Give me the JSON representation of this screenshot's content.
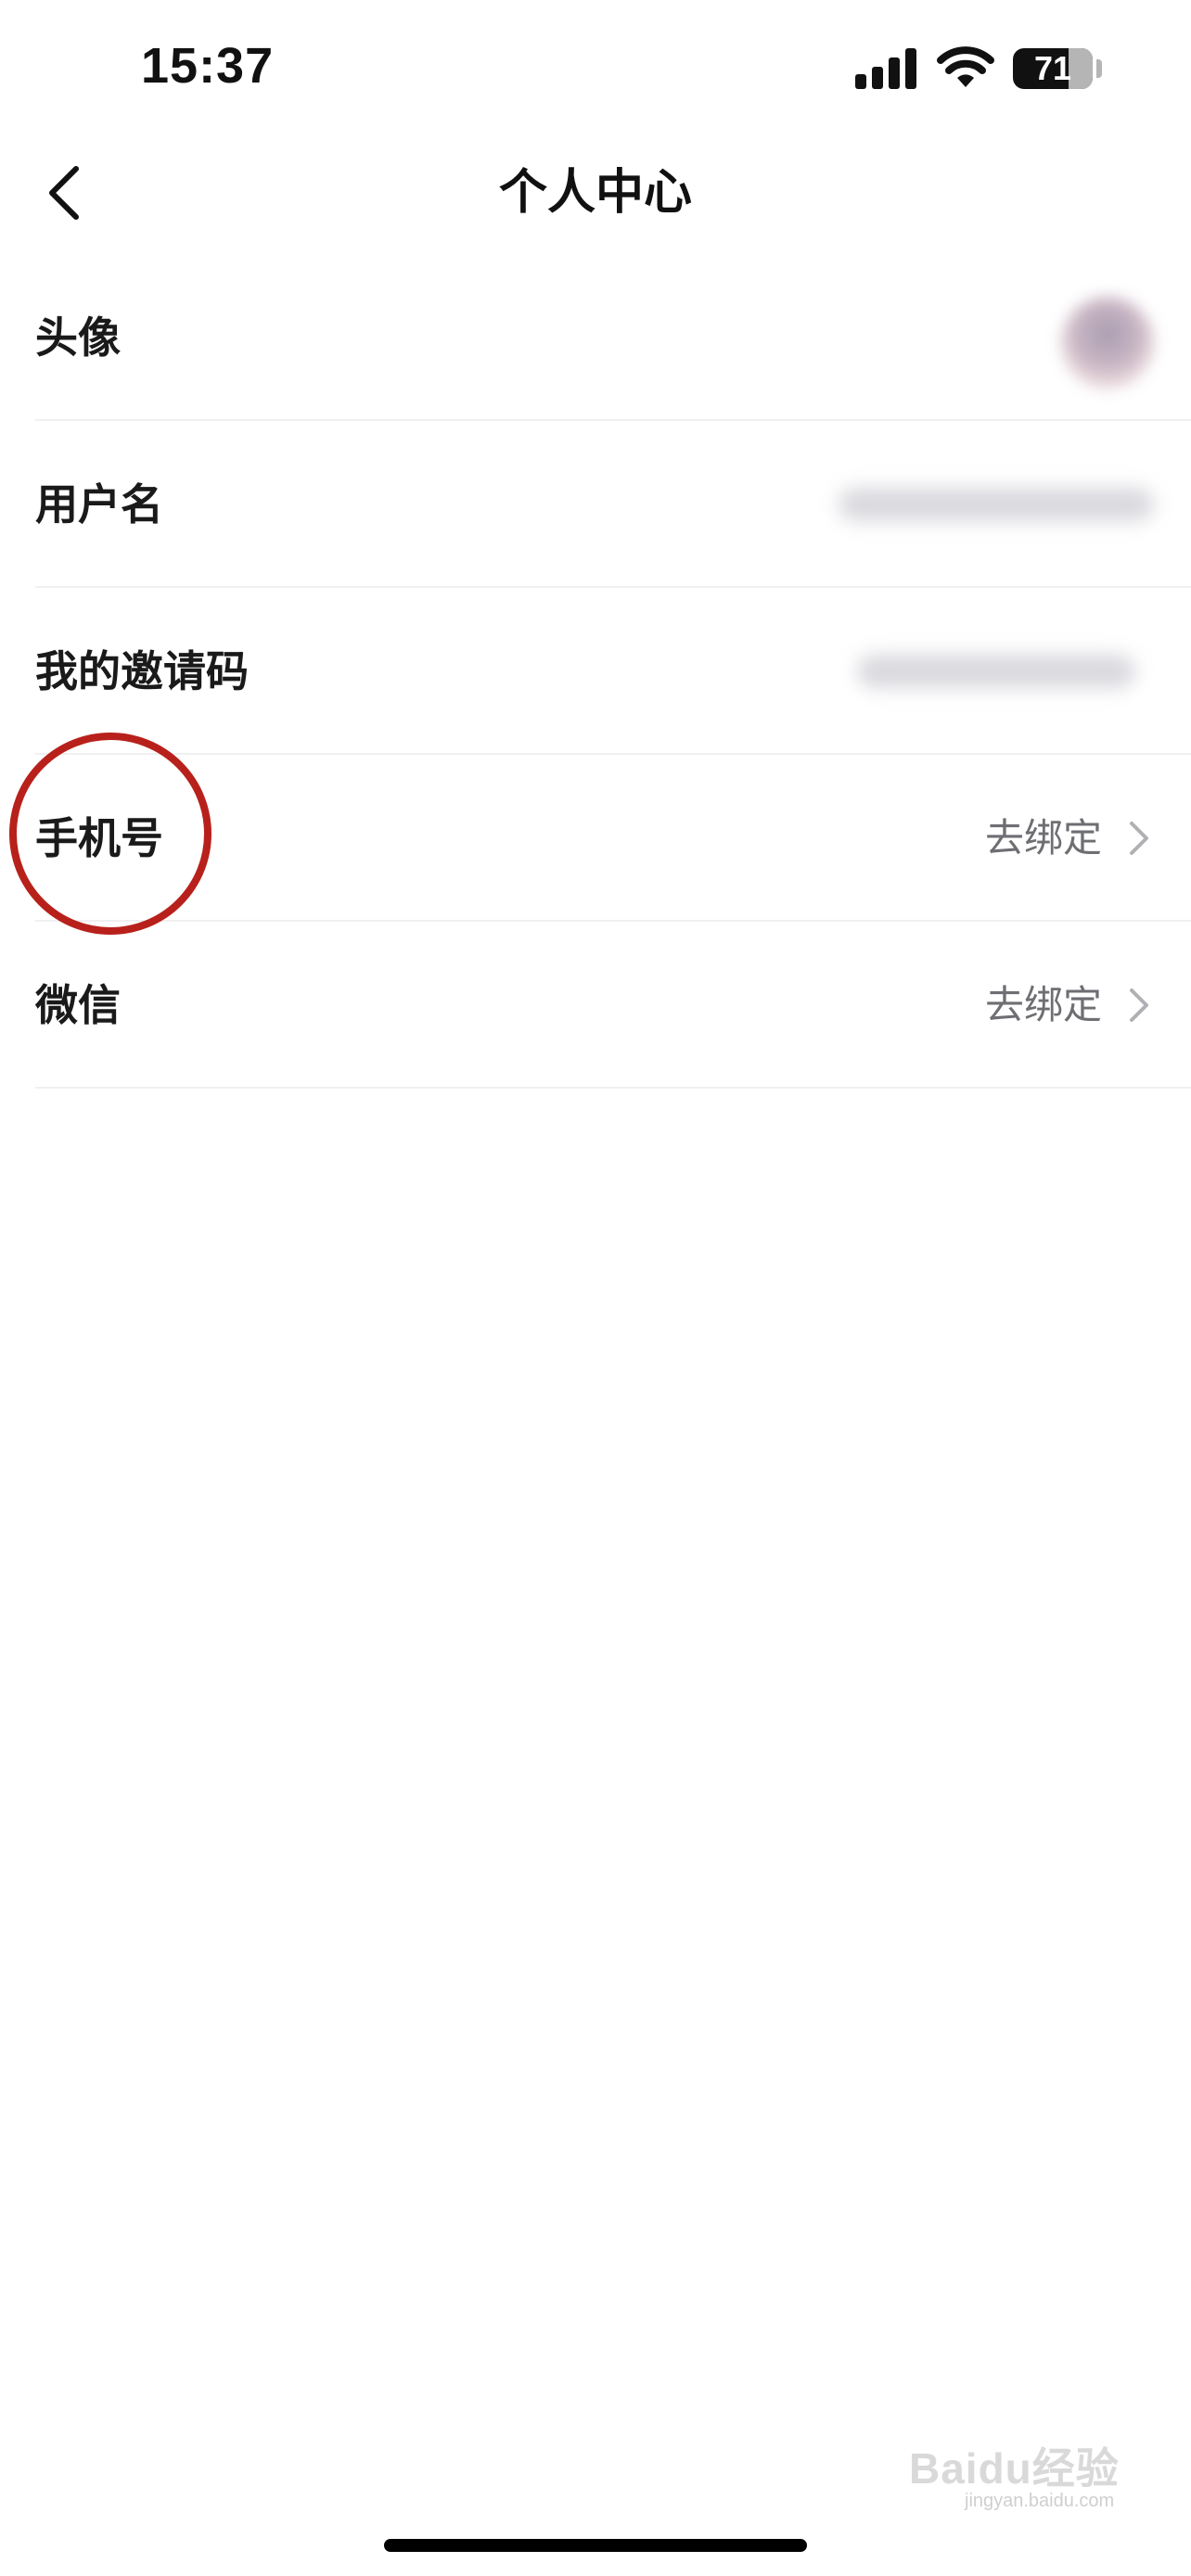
{
  "status_bar": {
    "time": "15:37",
    "battery": "71"
  },
  "nav": {
    "title": "个人中心",
    "back_icon": "chevron-left-icon"
  },
  "rows": [
    {
      "label": "头像"
    },
    {
      "label": "用户名"
    },
    {
      "label": "我的邀请码"
    },
    {
      "label": "手机号",
      "value": "去绑定"
    },
    {
      "label": "微信",
      "value": "去绑定"
    }
  ],
  "annotation": {
    "color": "#b8211b"
  },
  "watermark": {
    "brand": "Baidu经验",
    "url": "jingyan.baidu.com"
  }
}
